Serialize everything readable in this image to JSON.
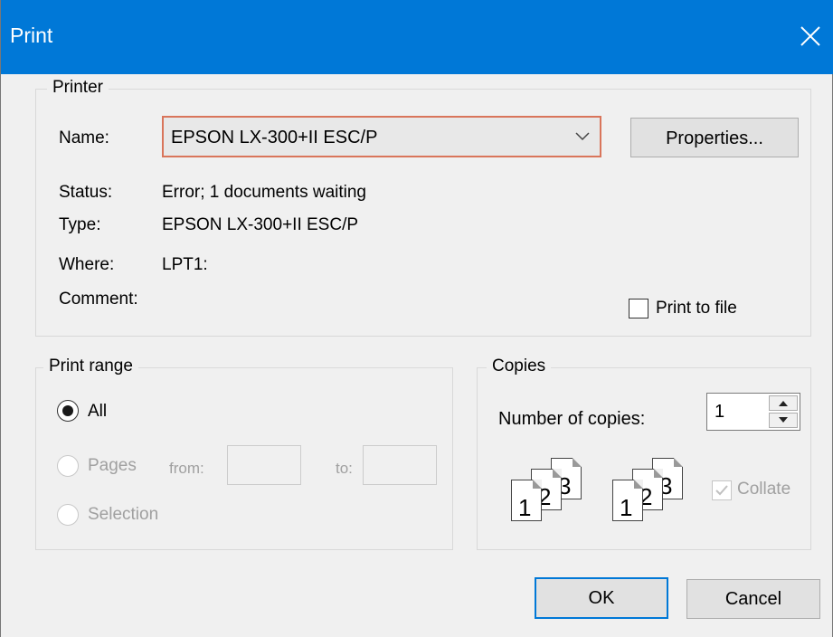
{
  "window": {
    "title": "Print"
  },
  "printer": {
    "legend": "Printer",
    "name_label": "Name:",
    "name_value": "EPSON LX-300+II ESC/P",
    "properties_button": "Properties...",
    "status_label": "Status:",
    "status_value": "Error; 1 documents waiting",
    "type_label": "Type:",
    "type_value": "EPSON LX-300+II ESC/P",
    "where_label": "Where:",
    "where_value": "LPT1:",
    "comment_label": "Comment:",
    "print_to_file_label": "Print to file",
    "print_to_file_checked": false
  },
  "print_range": {
    "legend": "Print range",
    "all_label": "All",
    "pages_label": "Pages",
    "from_label": "from:",
    "to_label": "to:",
    "from_value": "",
    "to_value": "",
    "selection_label": "Selection",
    "selected": "All"
  },
  "copies": {
    "legend": "Copies",
    "number_label": "Number of copies:",
    "number_value": "1",
    "collate_label": "Collate",
    "collate_checked": true,
    "page_numbers": [
      "1",
      "2",
      "3"
    ]
  },
  "buttons": {
    "ok": "OK",
    "cancel": "Cancel"
  },
  "colors": {
    "titlebar": "#0078d7",
    "focus_border": "#d9755b",
    "default_button_border": "#0078d7"
  }
}
